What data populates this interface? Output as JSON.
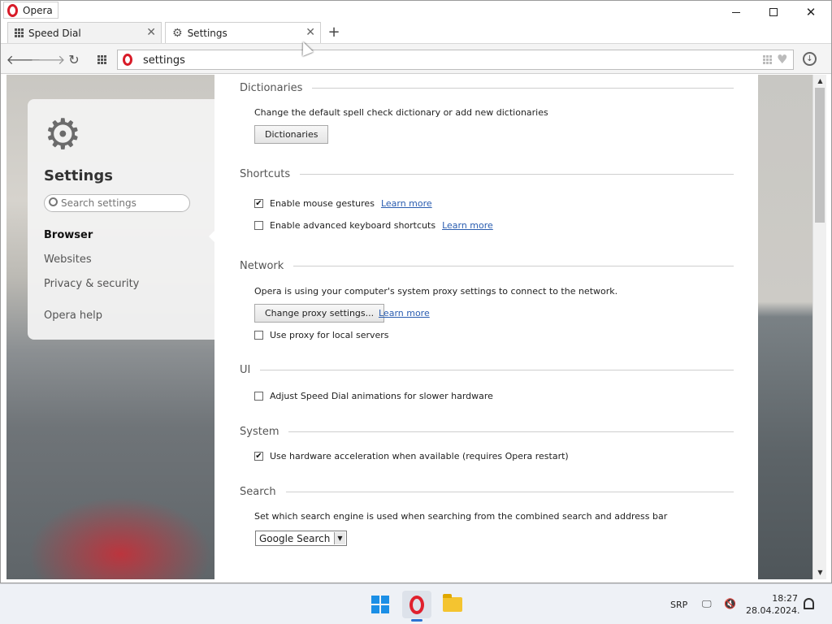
{
  "window": {
    "title": "Opera"
  },
  "tabs": [
    {
      "label": "Speed Dial"
    },
    {
      "label": "Settings"
    }
  ],
  "address": {
    "value": "settings"
  },
  "sidebar": {
    "title": "Settings",
    "search_placeholder": "Search settings",
    "items": [
      "Browser",
      "Websites",
      "Privacy & security"
    ],
    "active": "Browser",
    "help": "Opera help"
  },
  "sections": {
    "dictionaries": {
      "heading": "Dictionaries",
      "description": "Change the default spell check dictionary or add new dictionaries",
      "button": "Dictionaries"
    },
    "shortcuts": {
      "heading": "Shortcuts",
      "mouse_gestures": {
        "label": "Enable mouse gestures",
        "checked": true,
        "link": "Learn more"
      },
      "keyboard": {
        "label": "Enable advanced keyboard shortcuts",
        "checked": false,
        "link": "Learn more"
      }
    },
    "network": {
      "heading": "Network",
      "description": "Opera is using your computer's system proxy settings to connect to the network.",
      "button": "Change proxy settings...",
      "link": "Learn more",
      "local_proxy": {
        "label": "Use proxy for local servers",
        "checked": false
      }
    },
    "ui": {
      "heading": "UI",
      "speed_dial": {
        "label": "Adjust Speed Dial animations for slower hardware",
        "checked": false
      }
    },
    "system": {
      "heading": "System",
      "hw_accel": {
        "label": "Use hardware acceleration when available (requires Opera restart)",
        "checked": true
      }
    },
    "search": {
      "heading": "Search",
      "description": "Set which search engine is used when searching from the combined search and address bar",
      "engine": "Google Search"
    }
  },
  "taskbar": {
    "language": "SRP",
    "time": "18:27",
    "date": "28.04.2024."
  },
  "icons": {
    "check": "✔",
    "close": "✕",
    "plus": "+"
  },
  "colors": {
    "opera_red": "#d81b28",
    "link": "#2a5db0"
  }
}
